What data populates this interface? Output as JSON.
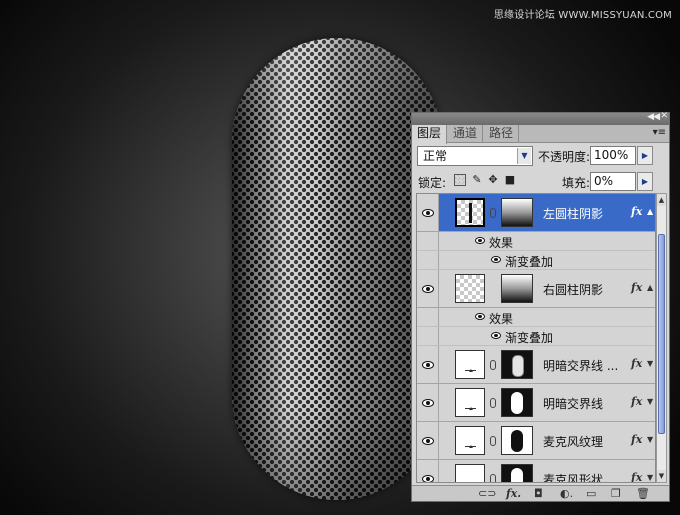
{
  "watermark": "思缘设计论坛 WWW.MISSYUAN.COM",
  "panel": {
    "tabs": [
      "图层",
      "通道",
      "路径"
    ],
    "active_tab": 0,
    "blend_mode": "正常",
    "opacity_label": "不透明度:",
    "opacity_value": "100%",
    "lock_label": "锁定:",
    "fill_label": "填充:",
    "fill_value": "0%",
    "collapse_icon": "double-chevron-left-icon",
    "menu_icon": "panel-menu-icon"
  },
  "layers": [
    {
      "name": "左圆柱阴影",
      "selected": true,
      "fx": "fx",
      "effects_label": "效果",
      "effect": "渐变叠加"
    },
    {
      "name": "右圆柱阴影",
      "selected": false,
      "fx": "fx",
      "effects_label": "效果",
      "effect": "渐变叠加"
    },
    {
      "name": "明暗交界线 ...",
      "selected": false,
      "fx": "fx"
    },
    {
      "name": "明暗交界线",
      "selected": false,
      "fx": "fx"
    },
    {
      "name": "麦克风纹理",
      "selected": false,
      "fx": "fx"
    },
    {
      "name": "麦克风形状",
      "selected": false,
      "fx": "fx"
    }
  ],
  "colors": {
    "selected_row": "#3a6ac8",
    "panel_bg": "#d6d6d6",
    "canvas_center": "#5a5a5a"
  }
}
